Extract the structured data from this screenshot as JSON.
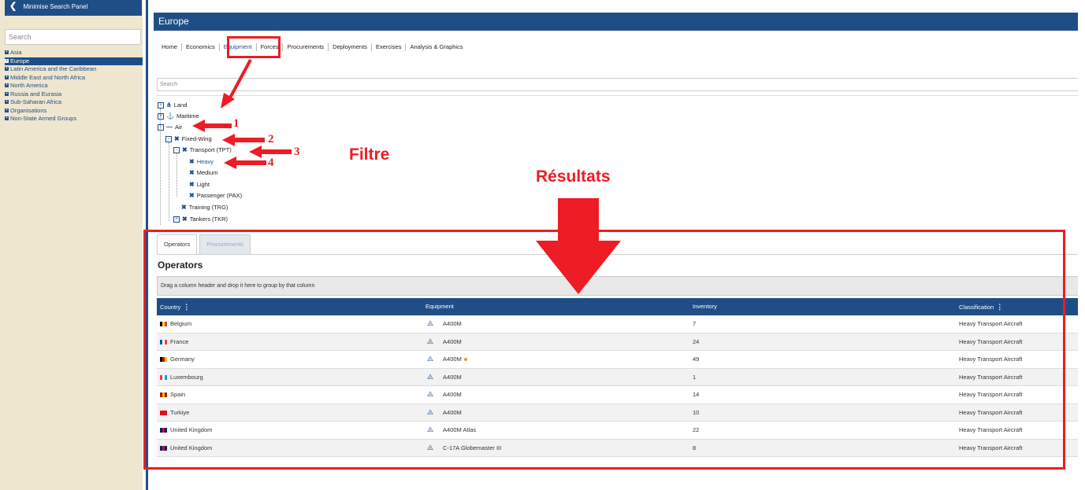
{
  "left_panel": {
    "minimise_label": "Minimise Search Panel",
    "search_placeholder": "Search",
    "regions": [
      {
        "label": "Asia"
      },
      {
        "label": "Europe"
      },
      {
        "label": "Latin America and the Caribbean"
      },
      {
        "label": "Middle East and North Africa"
      },
      {
        "label": "North America"
      },
      {
        "label": "Russia and Eurasia"
      },
      {
        "label": "Sub-Saharan Africa"
      },
      {
        "label": "Organisations"
      },
      {
        "label": "Non-State Armed Groups"
      }
    ],
    "active_region": "Europe"
  },
  "header": {
    "title": "Europe"
  },
  "nav": {
    "items": [
      "Home",
      "Economics",
      "Equipment",
      "Forces",
      "Procurements",
      "Deployments",
      "Exercises",
      "Analysis & Graphics"
    ],
    "active": "Equipment"
  },
  "filter": {
    "search_placeholder": "Search",
    "tree": {
      "land": "Land",
      "maritime": "Maritime",
      "air": "Air",
      "fixed_wing": "Fixed-Wing",
      "transport": "Transport (TPT)",
      "heavy": "Heavy",
      "medium": "Medium",
      "light": "Light",
      "passenger": "Passenger (PAX)",
      "training": "Training (TRG)",
      "tankers": "Tankers (TKR)"
    }
  },
  "annotations": {
    "n1": "1",
    "n2": "2",
    "n3": "3",
    "n4": "4",
    "filtre": "Filtre",
    "resultats": "Résultats"
  },
  "results": {
    "tabs": [
      "Operators",
      "Procurements"
    ],
    "active_tab": "Operators",
    "section_title": "Operators",
    "group_hint": "Drag a column header and drop it here to group by that column",
    "columns": [
      "Country",
      "Equipment",
      "Inventory",
      "Classification"
    ],
    "rows": [
      {
        "country": "Belgium",
        "equipment": "A400M",
        "inventory": "7",
        "classification": "Heavy Transport Aircraft",
        "flag": [
          "#000000",
          "#fdda24",
          "#ef3340"
        ]
      },
      {
        "country": "France",
        "equipment": "A400M",
        "inventory": "24",
        "classification": "Heavy Transport Aircraft",
        "flag": [
          "#0055a4",
          "#ffffff",
          "#ef4135"
        ]
      },
      {
        "country": "Germany",
        "equipment": "A400M",
        "inventory": "49",
        "classification": "Heavy Transport Aircraft",
        "flag": [
          "#000000",
          "#dd0000",
          "#ffce00"
        ]
      },
      {
        "country": "Luxembourg",
        "equipment": "A400M",
        "inventory": "1",
        "classification": "Heavy Transport Aircraft",
        "flag": [
          "#ef3340",
          "#ffffff",
          "#00a3e0"
        ]
      },
      {
        "country": "Spain",
        "equipment": "A400M",
        "inventory": "14",
        "classification": "Heavy Transport Aircraft",
        "flag": [
          "#aa151b",
          "#f1bf00",
          "#aa151b"
        ]
      },
      {
        "country": "Turkiye",
        "equipment": "A400M",
        "inventory": "10",
        "classification": "Heavy Transport Aircraft",
        "flag": [
          "#e30a17",
          "#e30a17",
          "#e30a17"
        ]
      },
      {
        "country": "United Kingdom",
        "equipment": "A400M Atlas",
        "inventory": "22",
        "classification": "Heavy Transport Aircraft",
        "flag": [
          "#012169",
          "#c8102e",
          "#012169"
        ]
      },
      {
        "country": "United Kingdom",
        "equipment": "C-17A Globemaster III",
        "inventory": "8",
        "classification": "Heavy Transport Aircraft",
        "flag": [
          "#012169",
          "#c8102e",
          "#012169"
        ]
      }
    ]
  },
  "colors": {
    "primary": "#1f4e87",
    "annotation_red": "#ee1c24",
    "panel_bg": "#efe6cf"
  }
}
